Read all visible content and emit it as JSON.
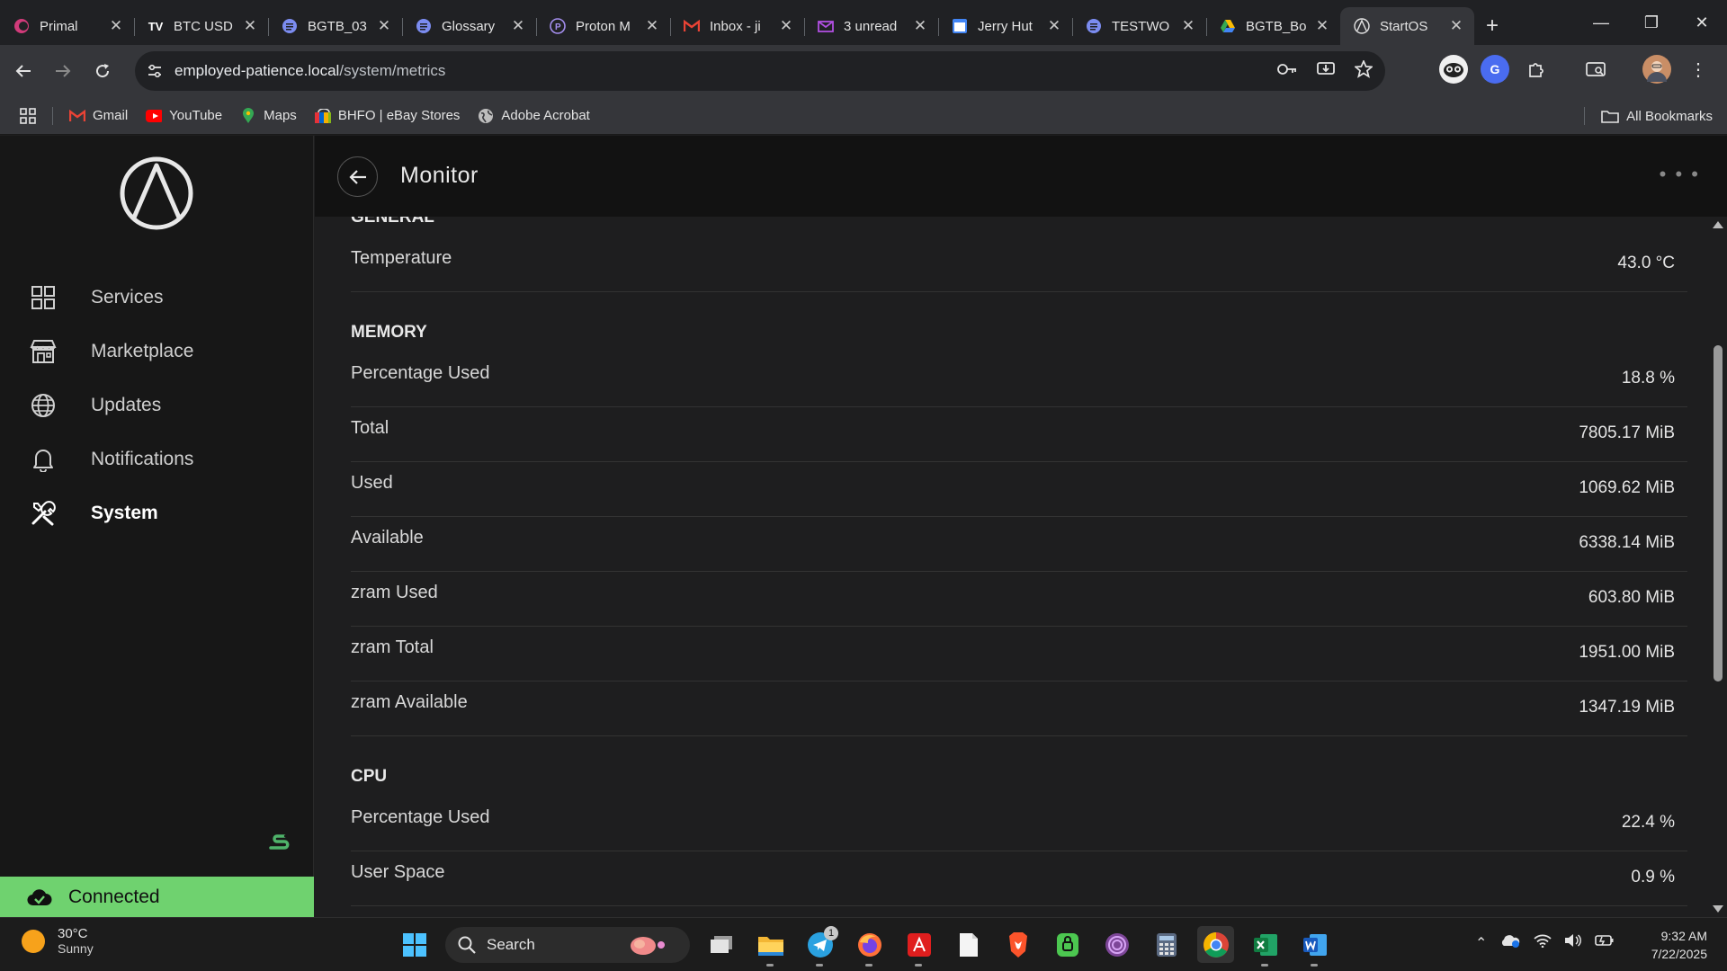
{
  "browser": {
    "tabs": [
      {
        "label": "Primal",
        "icon": "primal-icon",
        "color": "#d13b7a"
      },
      {
        "label": "BTC USD",
        "icon": "tradingview-icon",
        "color": "#ffffff"
      },
      {
        "label": "BGTB_03",
        "icon": "docs-icon",
        "color": "#7b8cf0"
      },
      {
        "label": "Glossary",
        "icon": "docs-icon",
        "color": "#7b8cf0"
      },
      {
        "label": "Proton M",
        "icon": "proton-icon",
        "color": "#a58ff0"
      },
      {
        "label": "Inbox - ji",
        "icon": "gmail-icon",
        "color": "#ea4335"
      },
      {
        "label": "3 unread",
        "icon": "mail-icon",
        "color": "#b04fe0"
      },
      {
        "label": "Jerry Hut",
        "icon": "calendar-icon",
        "color": "#4285f4"
      },
      {
        "label": "TESTWO",
        "icon": "docs-icon",
        "color": "#7b8cf0"
      },
      {
        "label": "BGTB_Bo",
        "icon": "drive-icon",
        "color": "#34a853"
      },
      {
        "label": "StartOS",
        "icon": "startos-icon",
        "color": "#e3e3e3"
      }
    ],
    "url_host": "employed-patience.local",
    "url_path": "/system/metrics",
    "bookmarks": [
      {
        "label": "Gmail",
        "icon": "gmail-icon",
        "color": "#ea4335"
      },
      {
        "label": "YouTube",
        "icon": "youtube-icon",
        "color": "#ff0000"
      },
      {
        "label": "Maps",
        "icon": "maps-icon",
        "color": "#34a853"
      },
      {
        "label": "BHFO | eBay Stores",
        "icon": "ebay-icon",
        "color": "#f5af02"
      },
      {
        "label": "Adobe Acrobat",
        "icon": "globe-icon",
        "color": "#bdbdbd"
      }
    ],
    "all_bookmarks": "All Bookmarks"
  },
  "sidebar": {
    "items": [
      {
        "label": "Services",
        "icon": "grid-icon"
      },
      {
        "label": "Marketplace",
        "icon": "store-icon"
      },
      {
        "label": "Updates",
        "icon": "globe-icon"
      },
      {
        "label": "Notifications",
        "icon": "bell-icon"
      },
      {
        "label": "System",
        "icon": "tools-icon",
        "active": true
      }
    ],
    "status": "Connected",
    "status_color": "#6fd26f"
  },
  "header": {
    "title": "Monitor"
  },
  "metrics": {
    "general": {
      "title": "GENERAL",
      "rows": [
        {
          "label": "Temperature",
          "value": "43.0 °C"
        }
      ]
    },
    "memory": {
      "title": "MEMORY",
      "rows": [
        {
          "label": "Percentage Used",
          "value": "18.8 %"
        },
        {
          "label": "Total",
          "value": "7805.17 MiB"
        },
        {
          "label": "Used",
          "value": "1069.62 MiB"
        },
        {
          "label": "Available",
          "value": "6338.14 MiB"
        },
        {
          "label": "zram Used",
          "value": "603.80 MiB"
        },
        {
          "label": "zram Total",
          "value": "1951.00 MiB"
        },
        {
          "label": "zram Available",
          "value": "1347.19 MiB"
        }
      ]
    },
    "cpu": {
      "title": "CPU",
      "rows": [
        {
          "label": "Percentage Used",
          "value": "22.4 %"
        },
        {
          "label": "User Space",
          "value": "0.9 %"
        }
      ]
    }
  },
  "taskbar": {
    "weather_temp": "30°C",
    "weather_desc": "Sunny",
    "search": "Search",
    "telegram_badge": "1",
    "time": "9:32 AM",
    "date": "7/22/2025"
  }
}
